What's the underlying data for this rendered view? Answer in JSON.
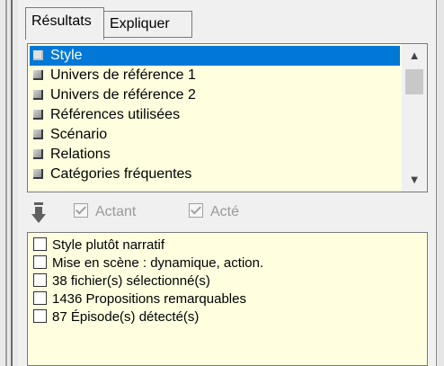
{
  "tabs": {
    "active": "Résultats",
    "inactive": "Expliquer"
  },
  "categories": [
    {
      "label": "Style",
      "selected": true
    },
    {
      "label": "Univers de référence 1",
      "selected": false
    },
    {
      "label": "Univers de référence 2",
      "selected": false
    },
    {
      "label": "Références utilisées",
      "selected": false
    },
    {
      "label": "Scénario",
      "selected": false
    },
    {
      "label": "Relations",
      "selected": false
    },
    {
      "label": "Catégories fréquentes",
      "selected": false
    }
  ],
  "scrollbar": {
    "up": "▲",
    "down": "▼"
  },
  "toolbar": {
    "icon": "down-arrow-icon",
    "actant_label": "Actant",
    "acte_label": "Acté",
    "actant_checked": true,
    "acte_checked": true,
    "disabled": true
  },
  "results": [
    "Style plutôt narratif",
    "Mise en scène : dynamique, action.",
    "38 fichier(s) sélectionné(s)",
    "1436 Propositions remarquables",
    "87 Épisode(s) détecté(s)"
  ],
  "colors": {
    "list_background": "#ffffe0",
    "selection": "#0078d7",
    "panel": "#f0f0f0"
  }
}
